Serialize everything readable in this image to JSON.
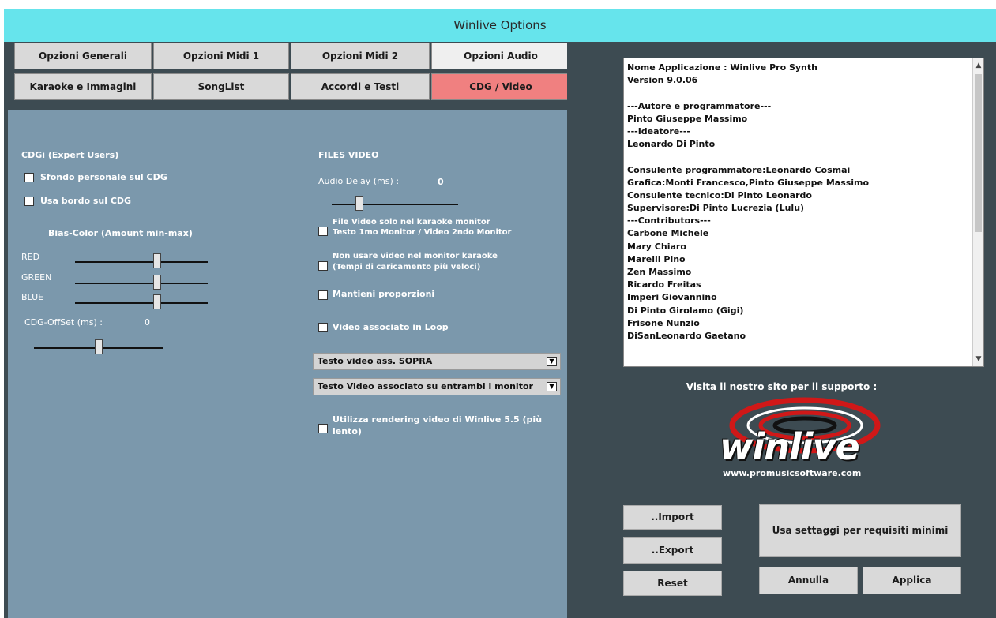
{
  "window": {
    "title": "Winlive  Options"
  },
  "tabs": [
    {
      "label": "Opzioni Generali"
    },
    {
      "label": "Opzioni Midi 1"
    },
    {
      "label": "Opzioni Midi 2"
    },
    {
      "label": "Opzioni Audio"
    },
    {
      "label": "Karaoke e Immagini"
    },
    {
      "label": "SongList"
    },
    {
      "label": "Accordi e Testi"
    },
    {
      "label": "CDG / Video"
    }
  ],
  "cdg": {
    "section_title": "CDGi (Expert Users)",
    "sfondo_label": "Sfondo personale sul CDG",
    "bordo_label": "Usa bordo sul CDG",
    "bias_title": "Bias-Color  (Amount min-max)",
    "red_label": "RED",
    "green_label": "GREEN",
    "blue_label": "BLUE",
    "offset_label": "CDG-OffSet (ms) :",
    "offset_value": "0"
  },
  "video": {
    "section_title": "FILES VIDEO",
    "audio_delay_label": "Audio Delay (ms) :",
    "audio_delay_value": "0",
    "opt1_line1": "File Video solo nel karaoke monitor",
    "opt1_line2": "Testo 1mo Monitor / Video 2ndo Monitor",
    "opt2_line1": "Non usare video nel monitor karaoke",
    "opt2_line2": "(Tempi di caricamento più veloci)",
    "opt3": "Mantieni proporzioni",
    "opt4": "Video associato in Loop",
    "select1": "Testo video ass. SOPRA",
    "select2": "Testo Video associato su entrambi i monitor",
    "opt5_line1": "Utilizza rendering video di Winlive 5.5 (più",
    "opt5_line2": "lento)"
  },
  "credits": [
    "Nome Applicazione : Winlive Pro Synth",
    "Version 9.0.06",
    "",
    "---Autore e programmatore---",
    "Pinto Giuseppe Massimo",
    "---Ideatore---",
    "Leonardo Di Pinto",
    "",
    "Consulente programmatore:Leonardo Cosmai",
    "Grafica:Monti Francesco,Pinto Giuseppe Massimo",
    "Consulente tecnico:Di Pinto Leonardo",
    "Supervisore:Di Pinto Lucrezia (Lulu)",
    "---Contributors---",
    "Carbone Michele",
    "Mary Chiaro",
    "Marelli Pino",
    "Zen Massimo",
    "Ricardo Freitas",
    "Imperi Giovannino",
    "Di Pinto Girolamo (Gigi)",
    "Frisone Nunzio",
    "DiSanLeonardo Gaetano"
  ],
  "support": {
    "visit_text": "Visita il nostro sito per il supporto :",
    "logo_text": "winlive",
    "url": "www.promusicsoftware.com"
  },
  "buttons": {
    "import": "..Import",
    "export": "..Export",
    "reset": "Reset",
    "minimi": "Usa settaggi per requisiti minimi",
    "annulla": "Annulla",
    "applica": "Applica"
  },
  "icons": {
    "scroll_up": "▲",
    "scroll_down": "▼",
    "dropdown": "▼"
  },
  "colors": {
    "titlebar": "#66e4ec",
    "panel": "#7b98ac",
    "dark": "#3d4b52",
    "selected_tab": "#f08080"
  }
}
